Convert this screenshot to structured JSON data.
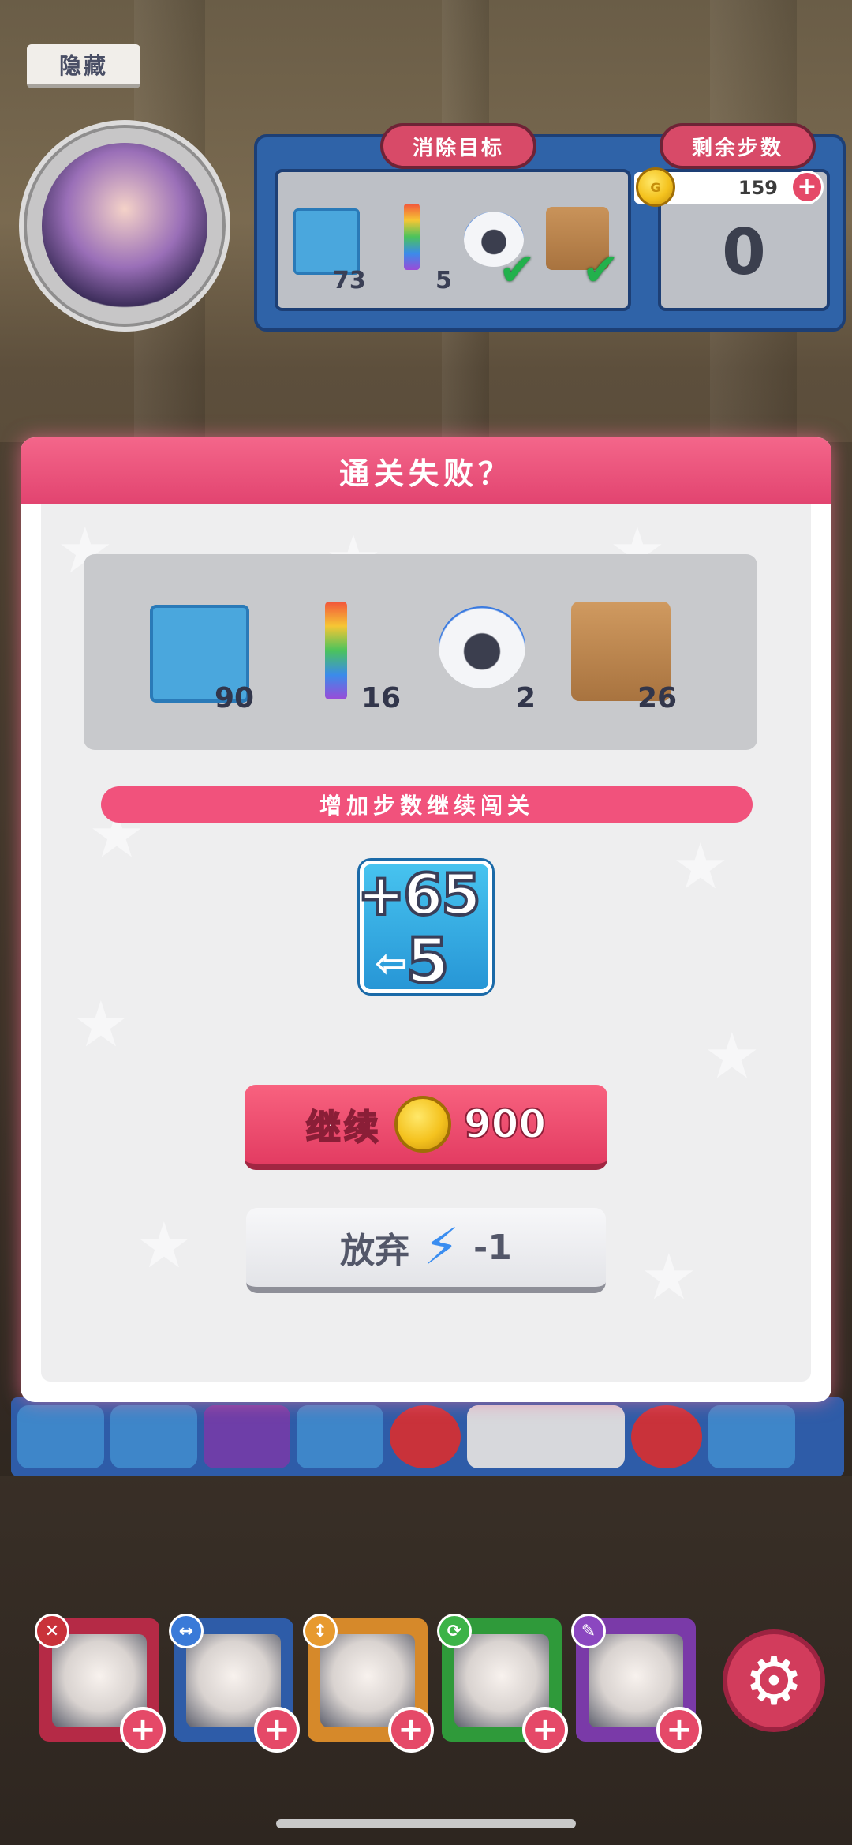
{
  "top_bar": {
    "hide_label": "隐藏"
  },
  "goal_panel": {
    "title": "消除目标",
    "items": [
      {
        "icon": "blue-block-icon",
        "count": "73"
      },
      {
        "icon": "rainbow-stick-icon",
        "count": "5"
      },
      {
        "icon": "robot-cat-icon",
        "status": "done"
      },
      {
        "icon": "cardboard-box-icon",
        "status": "done"
      }
    ]
  },
  "steps_panel": {
    "title": "剩余步数",
    "value": "0"
  },
  "coins": {
    "amount": "159"
  },
  "dialog": {
    "title": "通关失败？",
    "goals": [
      {
        "icon": "blue-block-icon",
        "count": "90"
      },
      {
        "icon": "rainbow-stick-icon",
        "count": "16"
      },
      {
        "icon": "robot-cat-icon",
        "count": "2"
      },
      {
        "icon": "cardboard-box-icon",
        "count": "26"
      }
    ],
    "banner": "增加步数继续闯关",
    "boost": {
      "plus_text": "+65",
      "steps_text": "5"
    },
    "continue_button": {
      "label": "继续",
      "price": "900"
    },
    "giveup_button": {
      "label": "放弃",
      "cost": "-1"
    }
  },
  "heroes": [
    {
      "skill_icon": "cross-icon",
      "skill_glyph": "✕",
      "frame_color": "#b52a46",
      "badge_color": "#c9323a"
    },
    {
      "skill_icon": "horizontal-arrows-icon",
      "skill_glyph": "↔",
      "frame_color": "#2e5ca8",
      "badge_color": "#3a7ad8"
    },
    {
      "skill_icon": "vertical-arrows-icon",
      "skill_glyph": "↕",
      "frame_color": "#d6892a",
      "badge_color": "#e79a2f"
    },
    {
      "skill_icon": "swap-icon",
      "skill_glyph": "⟳",
      "frame_color": "#2f9a3a",
      "badge_color": "#3cb347"
    },
    {
      "skill_icon": "wrench-icon",
      "skill_glyph": "✎",
      "frame_color": "#7a3aa8",
      "badge_color": "#8b47c0"
    }
  ],
  "colors": {
    "accent_pink": "#e24470",
    "panel_blue": "#2f63a8",
    "check_green": "#22b14c"
  }
}
